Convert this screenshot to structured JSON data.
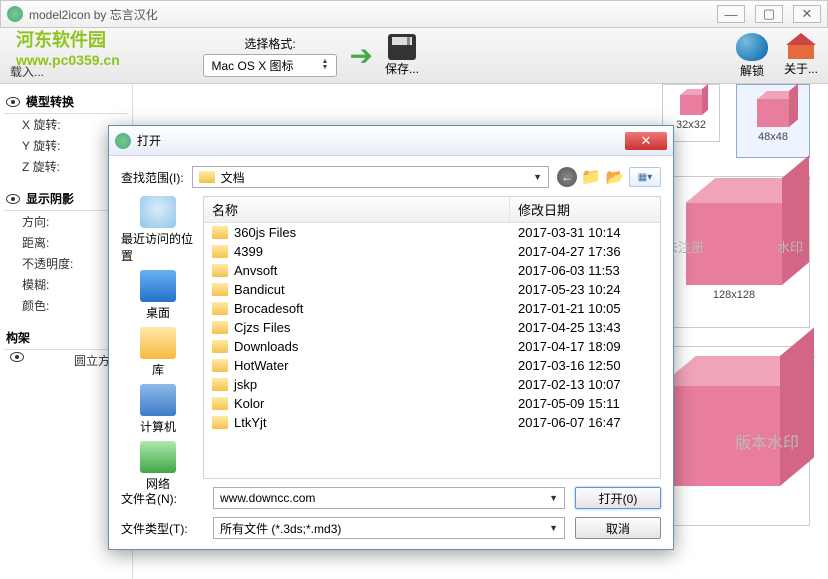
{
  "window": {
    "title": "model2icon by 忘言汉化"
  },
  "watermark": {
    "line1": "河东软件园",
    "line2": "www.pc0359.cn"
  },
  "toolbar": {
    "load_label": "载入...",
    "format_label": "选择格式:",
    "format_value": "Mac OS X 图标",
    "save_label": "保存...",
    "unlock_label": "解锁",
    "about_label": "关于..."
  },
  "sections": {
    "model": {
      "title": "模型转换",
      "rows": [
        {
          "label": "X 旋转:"
        },
        {
          "label": "Y 旋转:"
        },
        {
          "label": "Z 旋转:"
        }
      ]
    },
    "shadow": {
      "title": "显示阴影",
      "rows": [
        {
          "label": "方向:"
        },
        {
          "label": "距离:"
        },
        {
          "label": "不透明度:"
        },
        {
          "label": "模糊:"
        },
        {
          "label": "颜色:"
        }
      ]
    },
    "frame": {
      "title": "构架",
      "item": "圆立方体"
    }
  },
  "previews": {
    "s32": "32x32",
    "s48": "48x48",
    "s128": "128x128",
    "wm1": "未注册",
    "wm2": "水印",
    "bigwm": "版本水印"
  },
  "dialog": {
    "title": "打开",
    "look_in_label": "查找范围(I):",
    "look_in_value": "文档",
    "columns": {
      "name": "名称",
      "date": "修改日期"
    },
    "places": {
      "recent": "最近访问的位置",
      "desktop": "桌面",
      "libraries": "库",
      "computer": "计算机",
      "network": "网络"
    },
    "files": [
      {
        "name": "360js Files",
        "date": "2017-03-31 10:14"
      },
      {
        "name": "4399",
        "date": "2017-04-27 17:36"
      },
      {
        "name": "Anvsoft",
        "date": "2017-06-03 11:53"
      },
      {
        "name": "Bandicut",
        "date": "2017-05-23 10:24"
      },
      {
        "name": "Brocadesoft",
        "date": "2017-01-21 10:05"
      },
      {
        "name": "Cjzs Files",
        "date": "2017-04-25 13:43"
      },
      {
        "name": "Downloads",
        "date": "2017-04-17 18:09"
      },
      {
        "name": "HotWater",
        "date": "2017-03-16 12:50"
      },
      {
        "name": "jskp",
        "date": "2017-02-13 10:07"
      },
      {
        "name": "Kolor",
        "date": "2017-05-09 15:11"
      },
      {
        "name": "LtkYjt",
        "date": "2017-06-07 16:47"
      }
    ],
    "filename_label": "文件名(N):",
    "filename_value": "www.downcc.com",
    "filetype_label": "文件类型(T):",
    "filetype_value": "所有文件 (*.3ds;*.md3)",
    "open_btn": "打开(0)",
    "cancel_btn": "取消"
  }
}
